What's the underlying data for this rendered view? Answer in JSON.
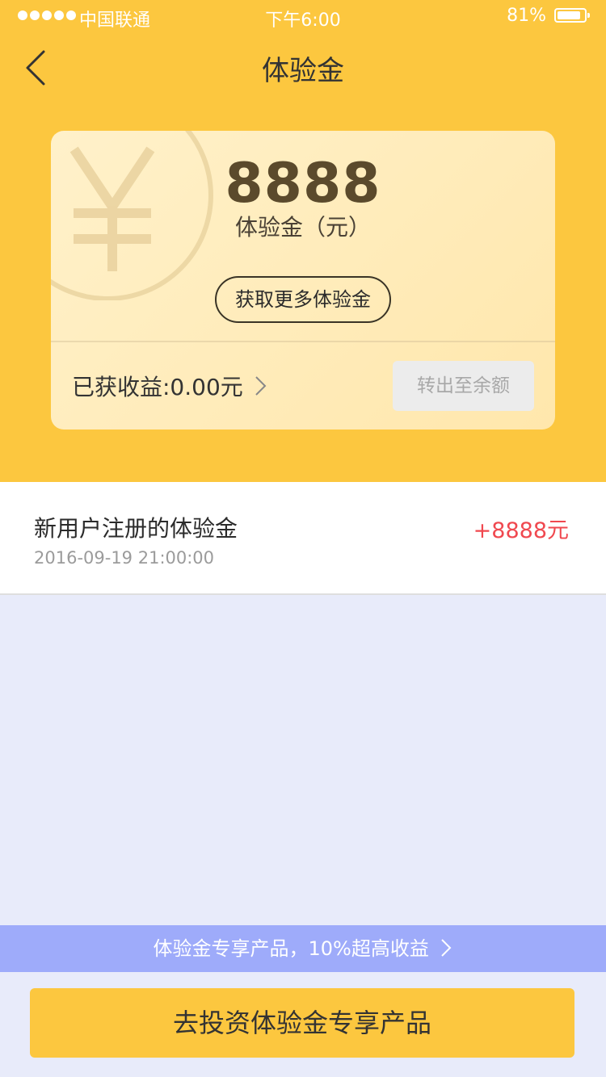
{
  "status_bar": {
    "carrier": "中国联通",
    "time": "下午6:00",
    "battery": "81%"
  },
  "nav": {
    "title": "体验金",
    "back_icon": "chevron-left-icon"
  },
  "card": {
    "amount": "8888",
    "amount_label": "体验金（元）",
    "more_button": "获取更多体验金",
    "earnings": "已获收益:0.00元",
    "transfer_button": "转出至余额",
    "deco_icon": "yen-icon"
  },
  "records": [
    {
      "title": "新用户注册的体验金",
      "date": "2016-09-19 21:00:00",
      "amount": "+8888元"
    }
  ],
  "promo": {
    "text": "体验金专享产品，10%超高收益"
  },
  "cta": {
    "label": "去投资体验金专享产品"
  },
  "colors": {
    "brand_yellow": "#fcc73f",
    "card_bg": "#ffecb8",
    "amount_positive": "#f0484f",
    "promo_bg": "#9eabfa",
    "page_bg": "#e8ebfa"
  }
}
